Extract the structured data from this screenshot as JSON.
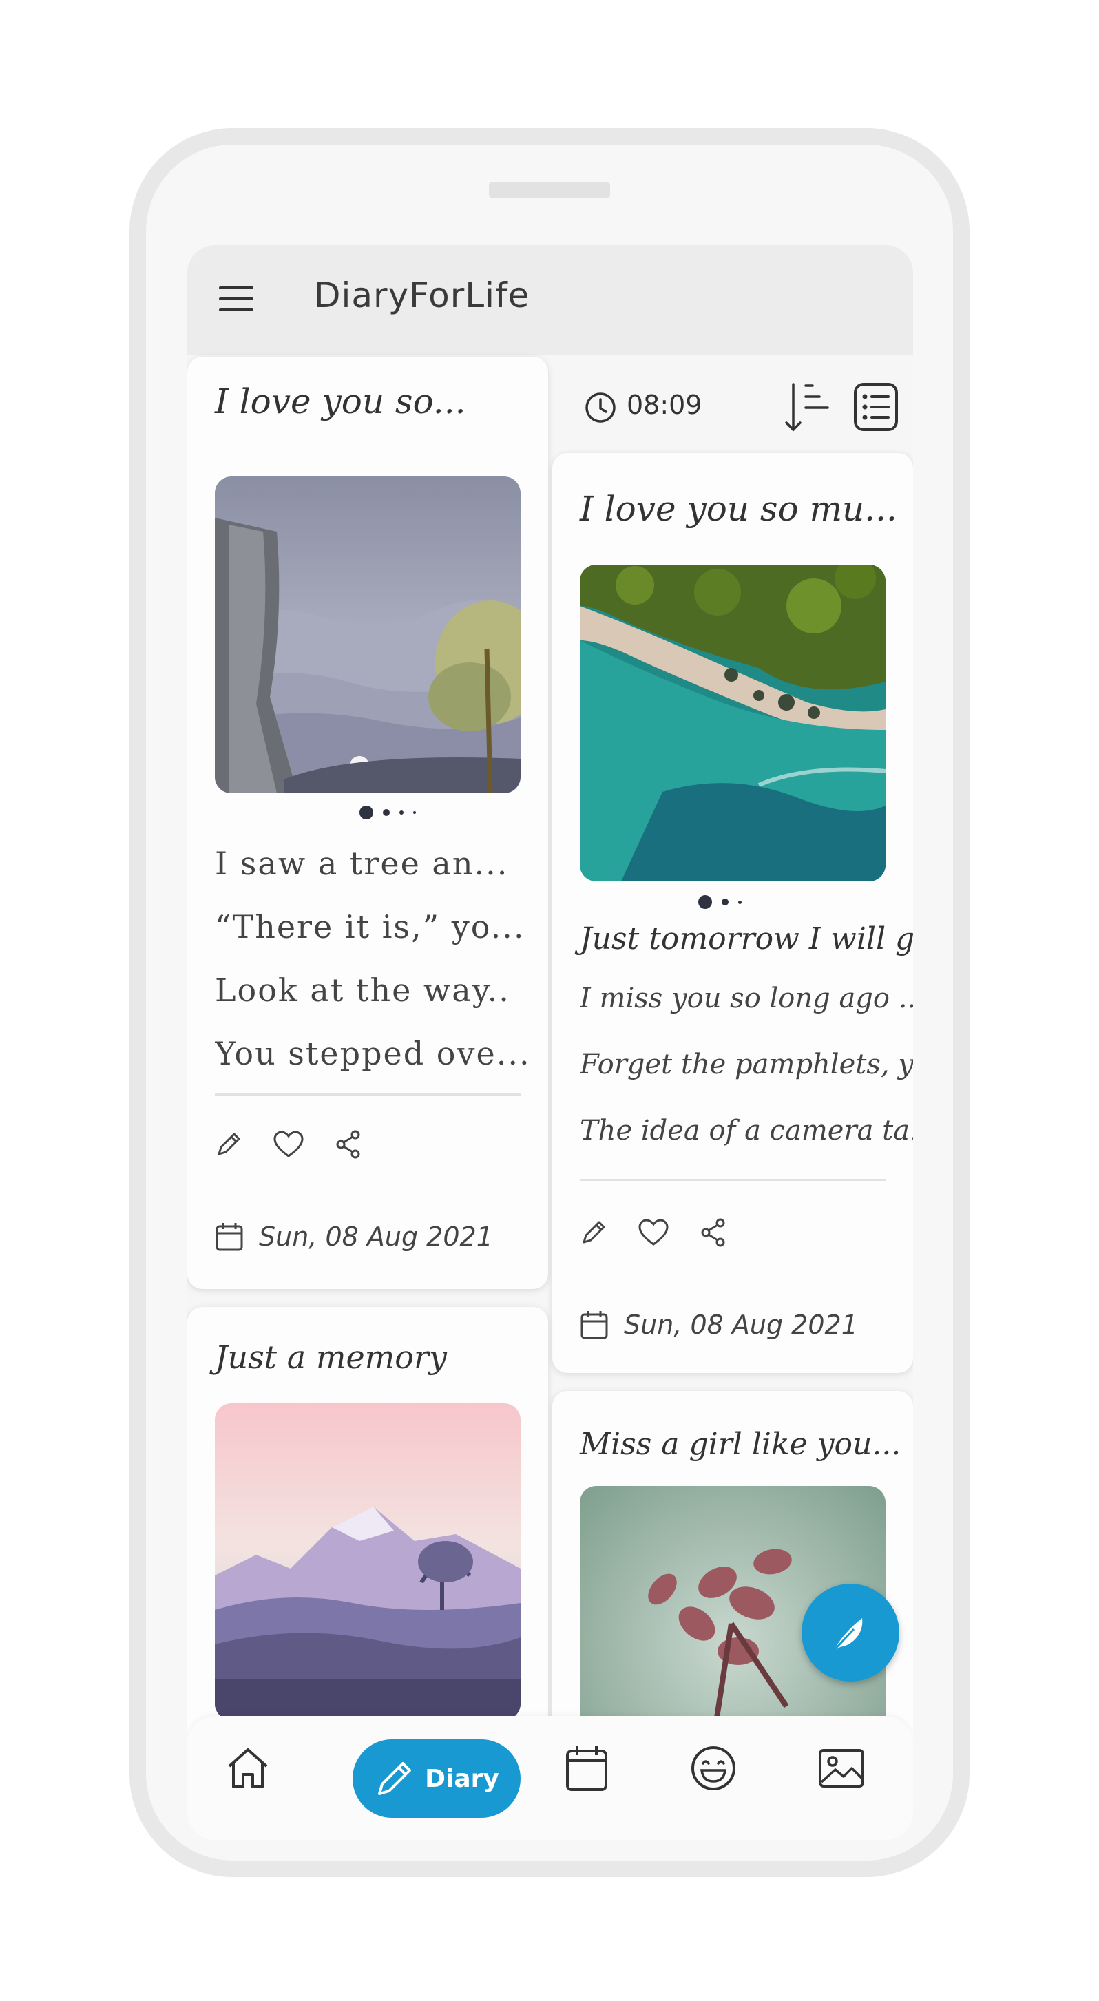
{
  "app": {
    "title": "DiaryForLife"
  },
  "toolbar": {
    "time": "08:09"
  },
  "cards": [
    {
      "title": "I love you so...",
      "lines": [
        "I saw a tree an...",
        "“There it is,” yo...",
        "Look at the way..",
        "You stepped ove..."
      ],
      "date": "Sun, 08 Aug 2021"
    },
    {
      "title": "I love you so mu...",
      "subtitle": "Just tomorrow I will go...",
      "lines": [
        "I miss you so long ago ....",
        "Forget the pamphlets, yo...",
        "The idea of a camera ta..."
      ],
      "date": "Sun, 08 Aug 2021"
    },
    {
      "title": "Just a memory"
    },
    {
      "title": "Miss a girl like you... ···"
    }
  ],
  "nav": {
    "diary_label": "Diary"
  },
  "colors": {
    "accent": "#1999d2",
    "dot": "#2f3340"
  },
  "icons": [
    "menu-icon",
    "clock-icon",
    "sort-icon",
    "list-view-icon",
    "pencil-icon",
    "heart-icon",
    "share-icon",
    "calendar-icon",
    "home-icon",
    "smiley-icon",
    "gallery-icon",
    "feather-icon"
  ]
}
